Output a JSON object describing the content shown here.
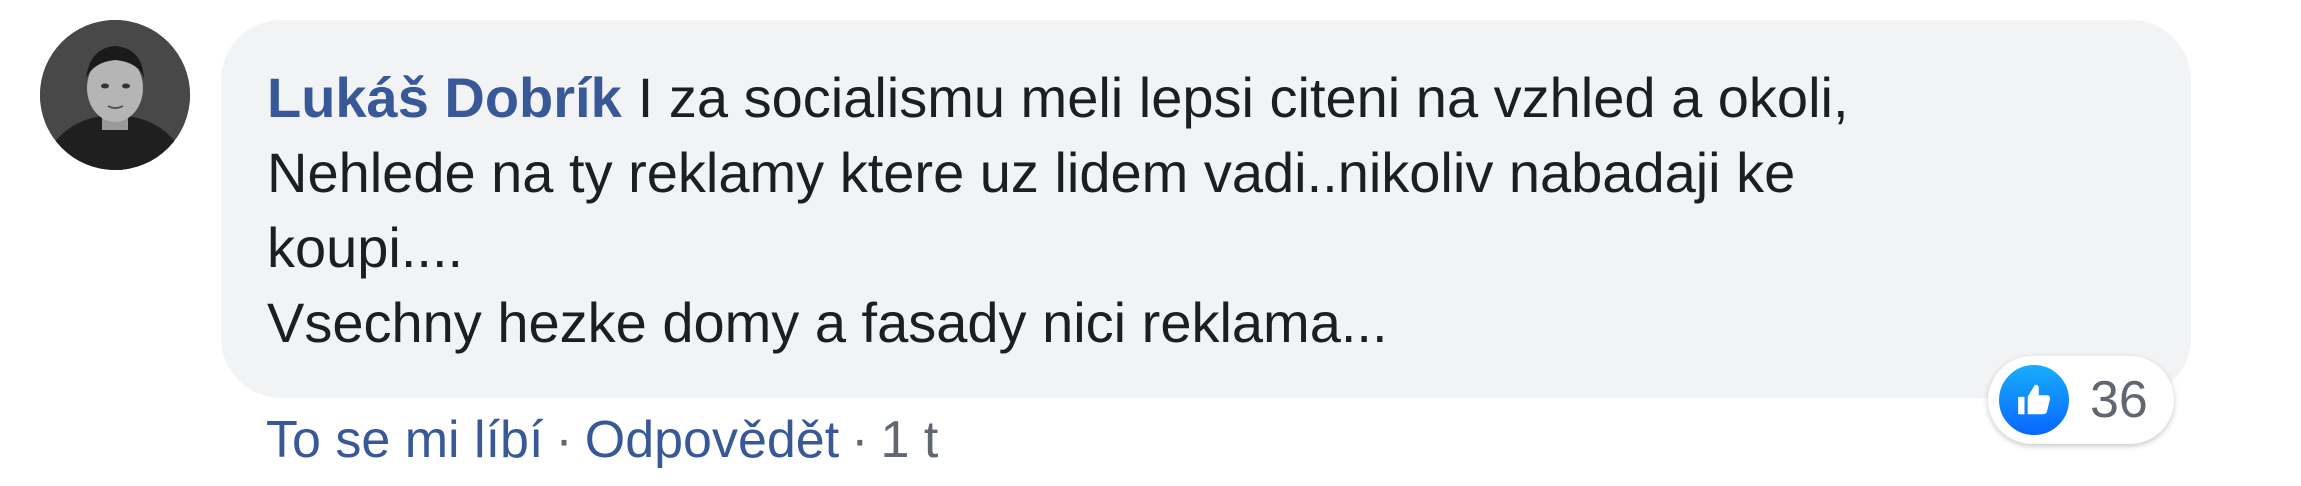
{
  "comment": {
    "author": "Lukáš Dobrík",
    "text_lines": [
      "I za socialismu meli lepsi citeni na vzhled a okoli,",
      "Nehlede na ty reklamy ktere uz lidem vadi..nikoliv nabadaji ke",
      "koupi....",
      "Vsechny hezke domy a fasady nici reklama..."
    ]
  },
  "actions": {
    "like_label": "To se mi líbí",
    "separator": "·",
    "reply_label": "Odpovědět",
    "timestamp": "1 t"
  },
  "reactions": {
    "icon": "thumbs-up-icon",
    "count": "36"
  },
  "colors": {
    "author": "#385898",
    "bubble": "#f2f3f5",
    "meta": "#606770",
    "like_blue": "#0866ff"
  }
}
